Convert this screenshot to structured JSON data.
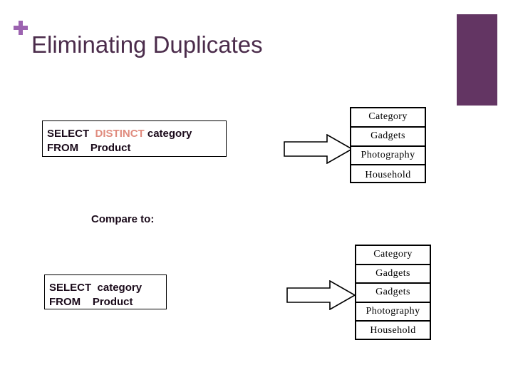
{
  "slide": {
    "title": "Eliminating Duplicates",
    "bullet_icon": "plus-icon",
    "accent_color": "#633563",
    "plus_color": "#9c63b0",
    "title_color": "#4b2c4b"
  },
  "query_distinct": {
    "line1_keyword": "SELECT",
    "line1_distinct": "DISTINCT",
    "line1_column": "category",
    "line2_keyword": "FROM",
    "line2_table": "Product",
    "full_text": "SELECT  DISTINCT category\nFROM    Product",
    "distinct_highlight_color": "#e08b7e"
  },
  "query_plain": {
    "line1_keyword": "SELECT",
    "line1_column": "category",
    "line2_keyword": "FROM",
    "line2_table": "Product",
    "full_text": "SELECT  category\nFROM    Product"
  },
  "compare_label": "Compare to:",
  "arrows": [
    {
      "name": "arrow-distinct-result",
      "direction": "right"
    },
    {
      "name": "arrow-plain-result",
      "direction": "right"
    }
  ],
  "result_distinct": {
    "header": "Category",
    "rows": [
      "Gadgets",
      "Photography",
      "Household"
    ]
  },
  "result_plain": {
    "header": "Category",
    "rows": [
      "Gadgets",
      "Gadgets",
      "Photography",
      "Household"
    ]
  }
}
